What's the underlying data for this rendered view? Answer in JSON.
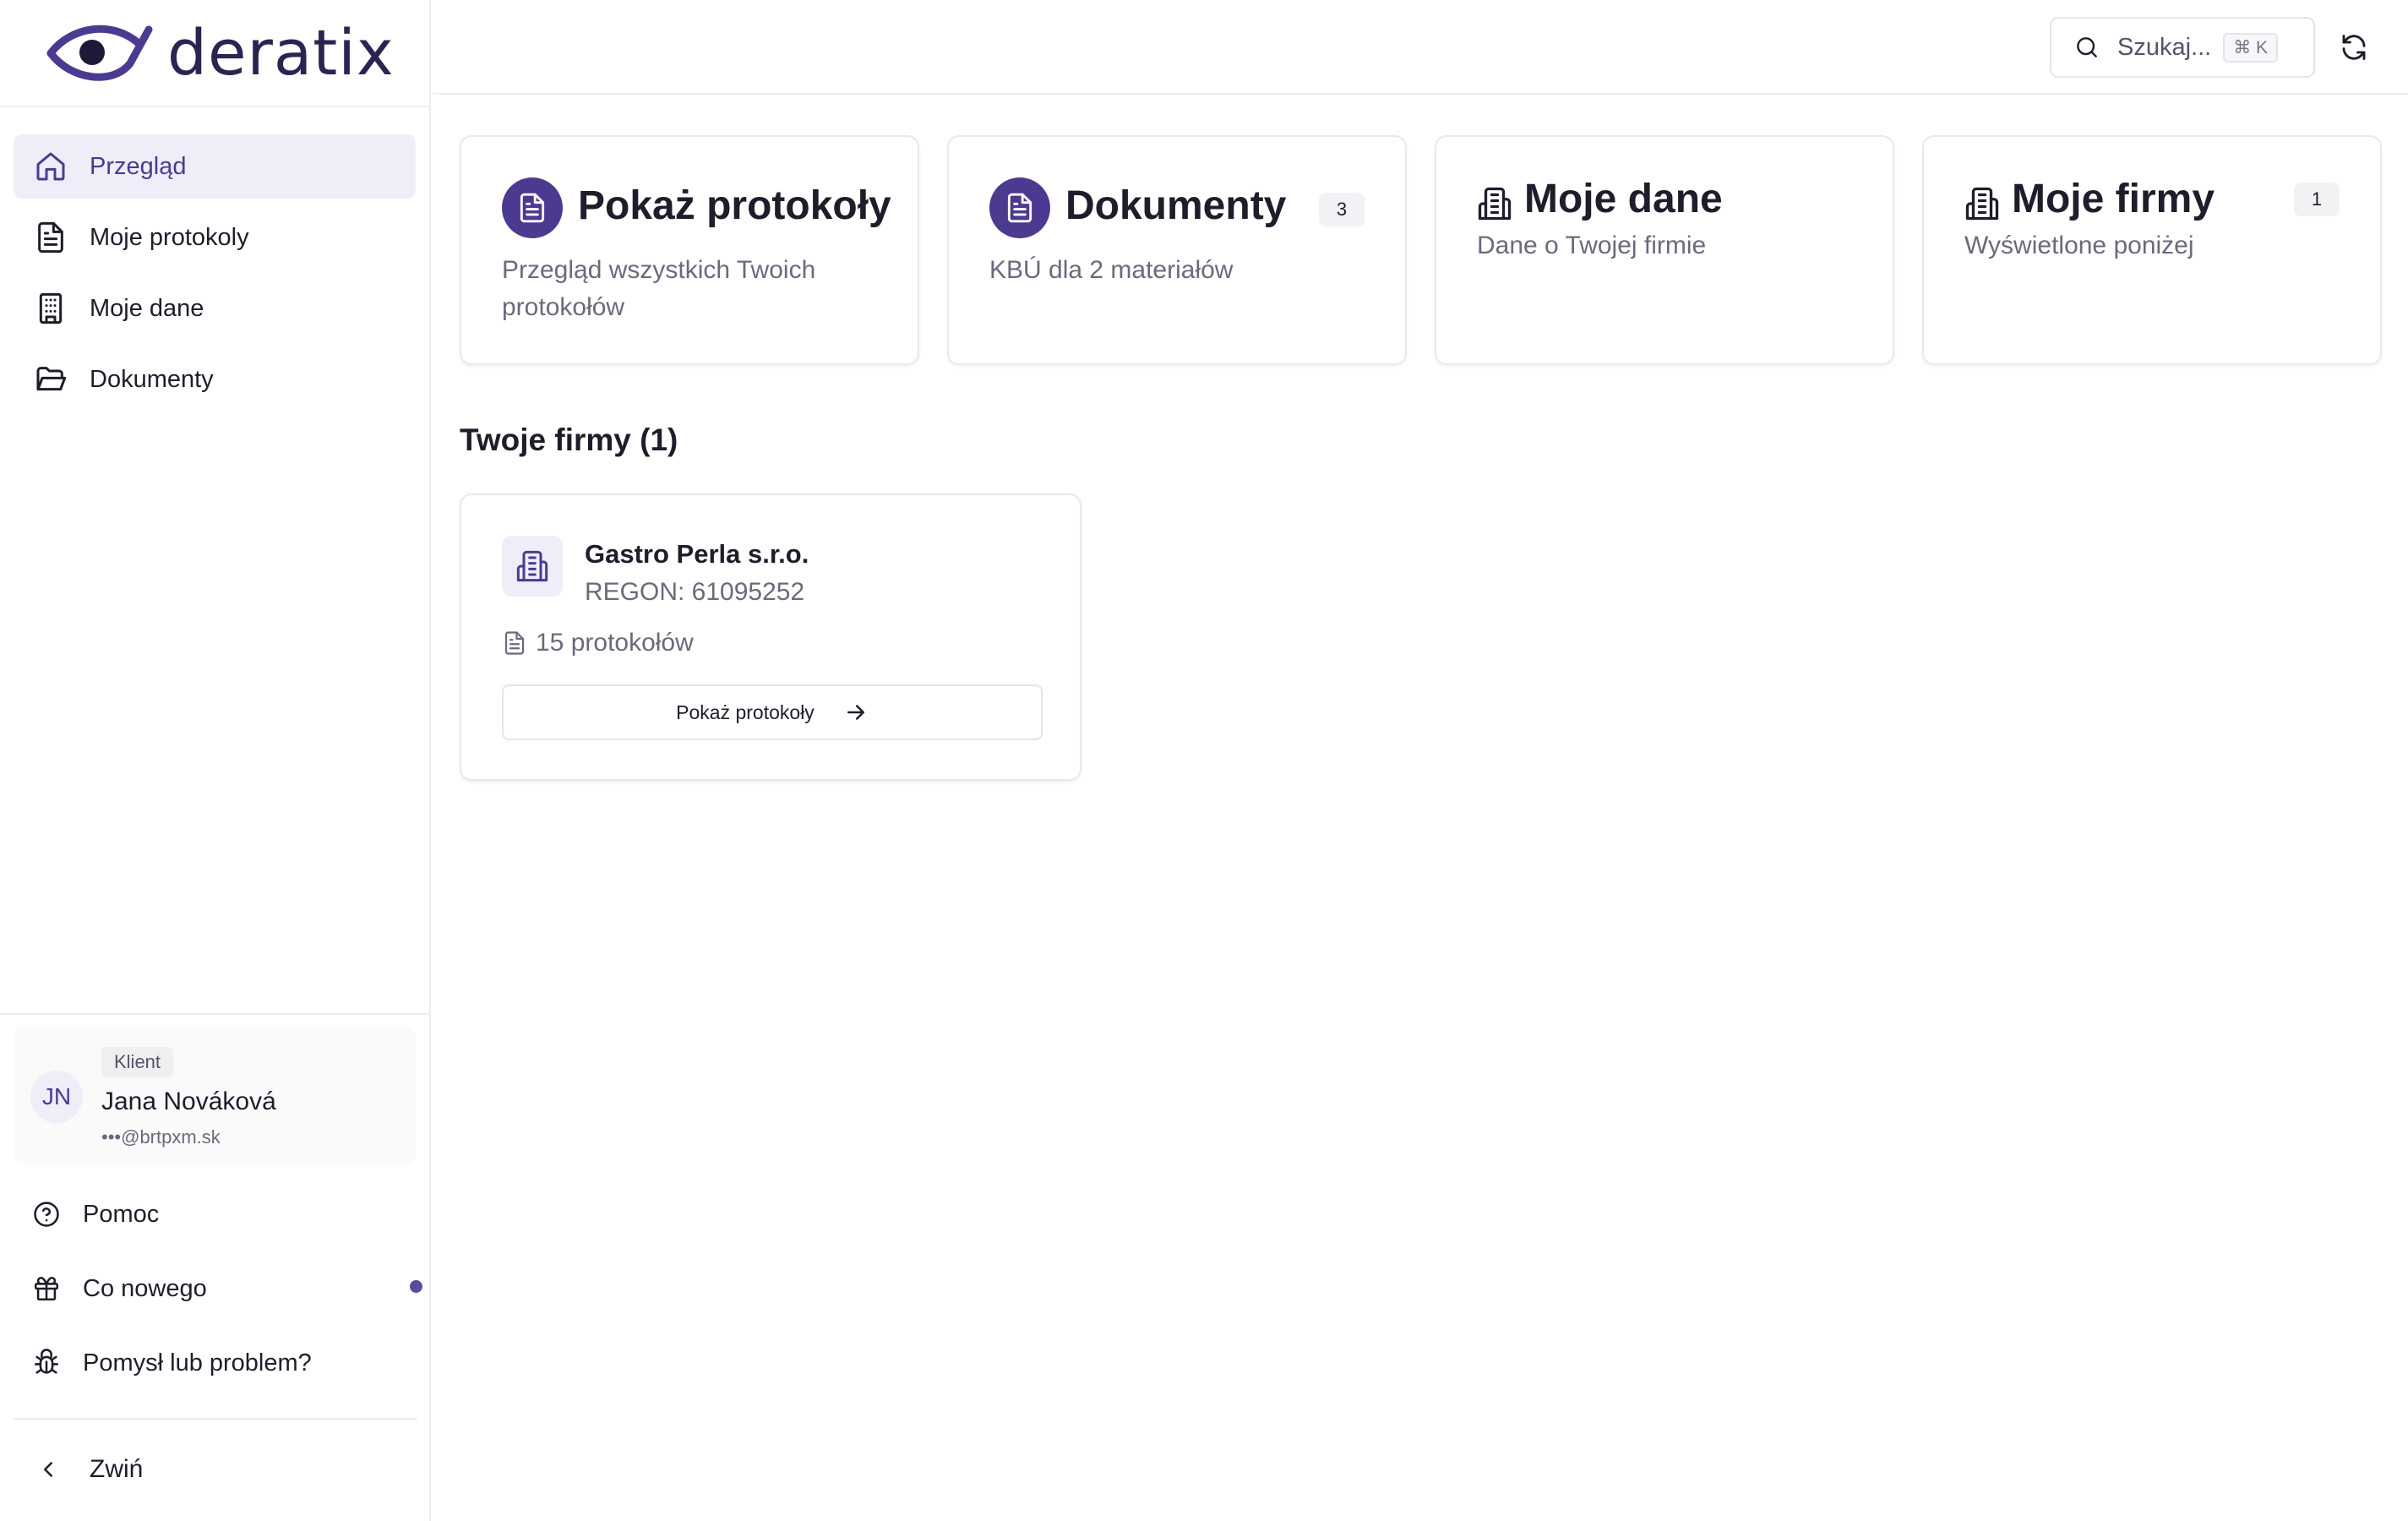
{
  "brand": {
    "name": "deratix",
    "accent": "#4c3a91"
  },
  "sidebar": {
    "items": [
      {
        "label": "Przegląd",
        "icon": "home-icon",
        "active": true
      },
      {
        "label": "Moje protokoly",
        "icon": "file-text-icon"
      },
      {
        "label": "Moje dane",
        "icon": "building-icon"
      },
      {
        "label": "Dokumenty",
        "icon": "folder-open-icon"
      }
    ],
    "user": {
      "initials": "JN",
      "role": "Klient",
      "name": "Jana Nováková",
      "email": "•••@brtpxm.sk"
    },
    "utility": [
      {
        "label": "Pomoc",
        "icon": "help-circle-icon"
      },
      {
        "label": "Co nowego",
        "icon": "gift-icon",
        "has_notification": true
      },
      {
        "label": "Pomysł lub problem?",
        "icon": "bug-icon"
      }
    ],
    "collapse_label": "Zwiń"
  },
  "topbar": {
    "search_placeholder": "Szukaj...",
    "shortcut": "⌘ K"
  },
  "cards": [
    {
      "title": "Pokaż protokoły",
      "description": "Przegląd wszystkich Twoich protokołów",
      "icon": "file-text-icon"
    },
    {
      "title": "Dokumenty",
      "description": "KBÚ dla 2 materiałów",
      "badge": "3",
      "icon": "file-text-icon"
    },
    {
      "title": "Moje dane",
      "description": "Dane o Twojej firmie",
      "icon": "building-icon"
    },
    {
      "title": "Moje firmy",
      "description": "Wyświetlone poniżej",
      "badge": "1",
      "icon": "building-icon"
    }
  ],
  "companies_section": {
    "title": "Twoje firmy (1)",
    "companies": [
      {
        "name": "Gastro Perla s.r.o.",
        "regon": "REGON: 61095252",
        "protocol_count": "15 protokołów",
        "button_label": "Pokaż protokoły"
      }
    ]
  }
}
